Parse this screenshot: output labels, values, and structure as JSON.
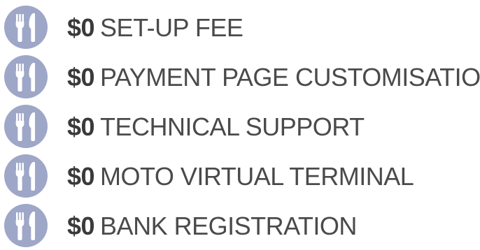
{
  "colors": {
    "icon_bg": "#9ea7c8",
    "icon_glyph": "#ffffff",
    "text": "#4a4a4a",
    "price": "#3a3a3a"
  },
  "features": [
    {
      "icon": "fork-knife-icon",
      "price": "$0",
      "label": "SET-UP FEE"
    },
    {
      "icon": "fork-knife-icon",
      "price": "$0",
      "label": "PAYMENT PAGE CUSTOMISATION"
    },
    {
      "icon": "fork-knife-icon",
      "price": "$0",
      "label": "TECHNICAL SUPPORT"
    },
    {
      "icon": "fork-knife-icon",
      "price": "$0",
      "label": "MOTO VIRTUAL TERMINAL"
    },
    {
      "icon": "fork-knife-icon",
      "price": "$0",
      "label": "BANK REGISTRATION"
    }
  ]
}
